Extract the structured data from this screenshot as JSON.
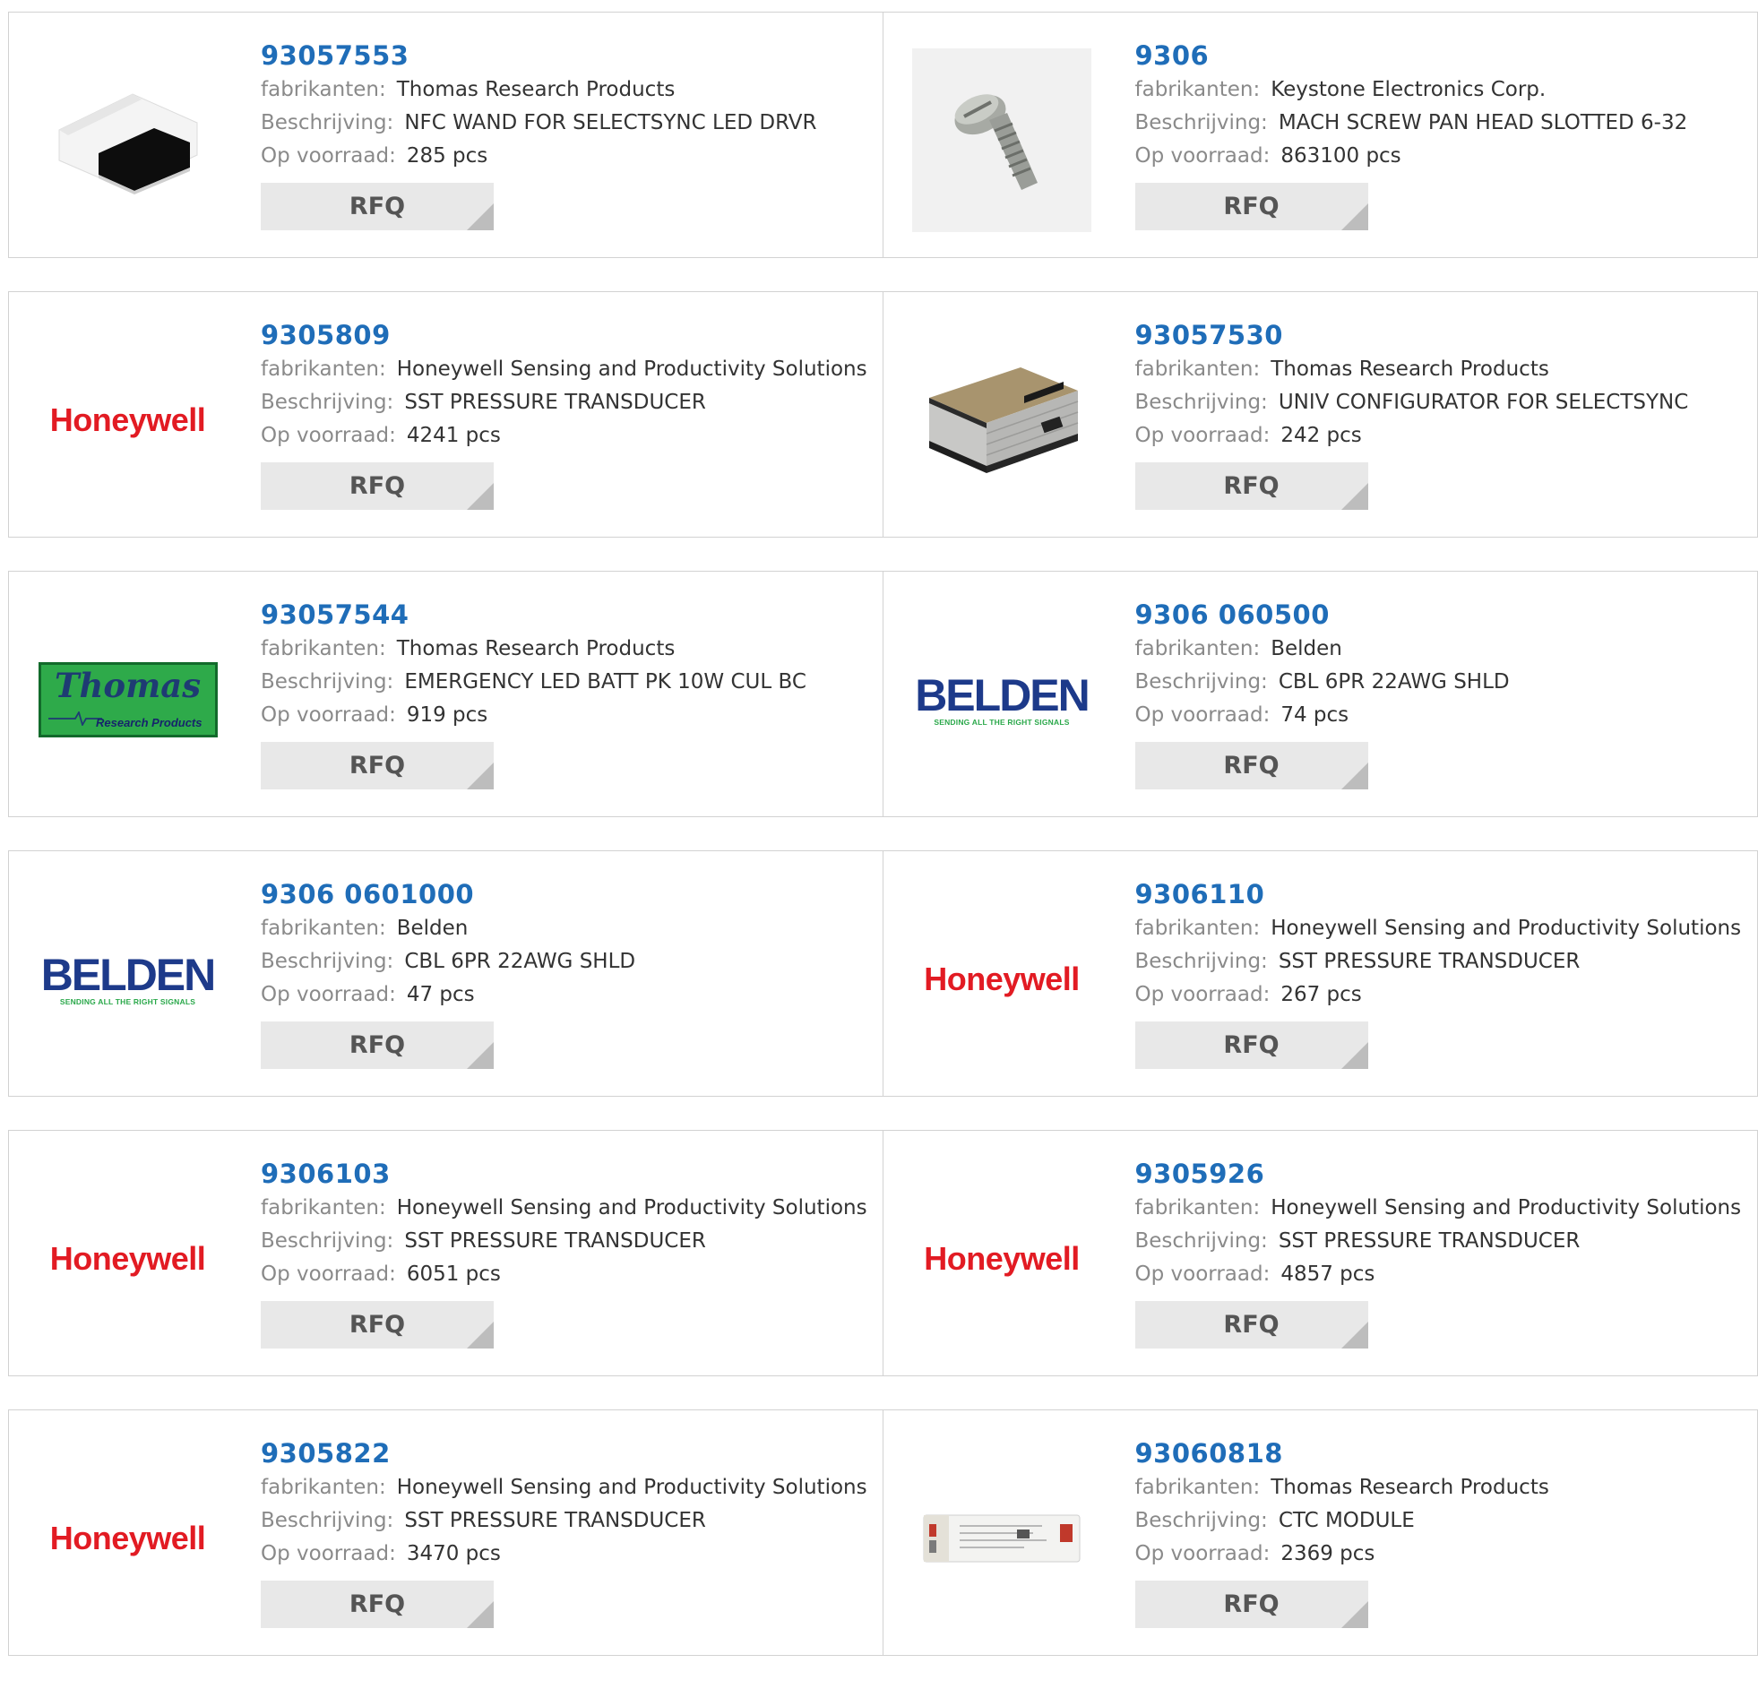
{
  "labels": {
    "manufacturer": "fabrikanten:",
    "description": "Beschrijving:",
    "stock": "Op voorraad:",
    "rfq": "RFQ"
  },
  "logos": {
    "honeywell": "Honeywell",
    "belden": "BELDEN",
    "belden_tagline": "SENDING ALL THE RIGHT SIGNALS",
    "thomas": "Thomas",
    "thomas_tagline": "Research Products"
  },
  "colors": {
    "part_link": "#1f6db8",
    "label_gray": "#8a8a8a",
    "rfq_bg": "#e8e8e8",
    "honeywell_red": "#e21b23",
    "belden_blue": "#1d3a8a",
    "belden_green": "#2aa84a",
    "thomas_green": "#2eaa4a"
  },
  "products": [
    {
      "part": "93057553",
      "manufacturer": "Thomas Research Products",
      "description": "NFC WAND FOR SELECTSYNC LED DRVR",
      "stock": "285 pcs",
      "image": "nfc-wand-photo"
    },
    {
      "part": "9306",
      "manufacturer": "Keystone Electronics Corp.",
      "description": "MACH SCREW PAN HEAD SLOTTED 6-32",
      "stock": "863100 pcs",
      "image": "screw-photo"
    },
    {
      "part": "9305809",
      "manufacturer": "Honeywell Sensing and Productivity Solutions",
      "description": "SST PRESSURE TRANSDUCER",
      "stock": "4241 pcs",
      "image": "honeywell-logo"
    },
    {
      "part": "93057530",
      "manufacturer": "Thomas Research Products",
      "description": "UNIV CONFIGURATOR FOR SELECTSYNC",
      "stock": "242 pcs",
      "image": "configurator-box-photo"
    },
    {
      "part": "93057544",
      "manufacturer": "Thomas Research Products",
      "description": "EMERGENCY LED BATT PK 10W CUL BC",
      "stock": "919 pcs",
      "image": "thomas-logo"
    },
    {
      "part": "9306 060500",
      "manufacturer": "Belden",
      "description": "CBL 6PR 22AWG SHLD",
      "stock": "74 pcs",
      "image": "belden-logo"
    },
    {
      "part": "9306 0601000",
      "manufacturer": "Belden",
      "description": "CBL 6PR 22AWG SHLD",
      "stock": "47 pcs",
      "image": "belden-logo"
    },
    {
      "part": "9306110",
      "manufacturer": "Honeywell Sensing and Productivity Solutions",
      "description": "SST PRESSURE TRANSDUCER",
      "stock": "267 pcs",
      "image": "honeywell-logo"
    },
    {
      "part": "9306103",
      "manufacturer": "Honeywell Sensing and Productivity Solutions",
      "description": "SST PRESSURE TRANSDUCER",
      "stock": "6051 pcs",
      "image": "honeywell-logo"
    },
    {
      "part": "9305926",
      "manufacturer": "Honeywell Sensing and Productivity Solutions",
      "description": "SST PRESSURE TRANSDUCER",
      "stock": "4857 pcs",
      "image": "honeywell-logo"
    },
    {
      "part": "9305822",
      "manufacturer": "Honeywell Sensing and Productivity Solutions",
      "description": "SST PRESSURE TRANSDUCER",
      "stock": "3470 pcs",
      "image": "honeywell-logo"
    },
    {
      "part": "93060818",
      "manufacturer": "Thomas Research Products",
      "description": "CTC MODULE",
      "stock": "2369 pcs",
      "image": "ctc-module-photo"
    }
  ]
}
